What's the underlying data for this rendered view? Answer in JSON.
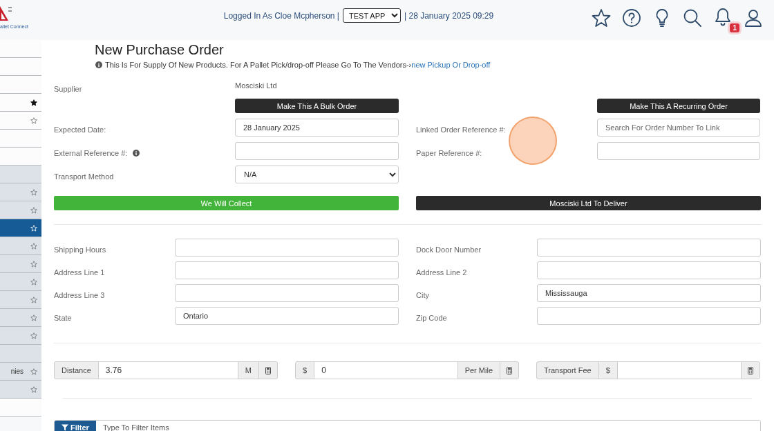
{
  "header": {
    "logo_text": "allet Connect",
    "user_text": "Logged In As Cloe Mcpherson |",
    "app_select": "TEST APP",
    "datetime": "| 28 January 2025 09:29",
    "notification_count": "1"
  },
  "sidebar": {
    "items": [
      {
        "selected": false,
        "shaded": false
      },
      {
        "selected": false,
        "shaded": false
      },
      {
        "selected": false,
        "shaded": false
      },
      {
        "selected": false,
        "shaded": false,
        "starred": true
      },
      {
        "selected": false,
        "shaded": false,
        "starred": false
      },
      {
        "selected": false,
        "shaded": false
      },
      {
        "selected": false,
        "shaded": false
      },
      {
        "selected": false,
        "shaded": true
      },
      {
        "selected": false,
        "shaded": true,
        "starred": false
      },
      {
        "selected": false,
        "shaded": true,
        "starred": false
      },
      {
        "selected": true,
        "shaded": true,
        "starred": false
      },
      {
        "selected": false,
        "shaded": true,
        "starred": false
      },
      {
        "selected": false,
        "shaded": true,
        "starred": false
      },
      {
        "selected": false,
        "shaded": true,
        "starred": false
      },
      {
        "selected": false,
        "shaded": true,
        "starred": false
      },
      {
        "selected": false,
        "shaded": true,
        "starred": false
      },
      {
        "selected": false,
        "shaded": true,
        "starred": false
      },
      {
        "selected": false,
        "shaded": true
      },
      {
        "selected": false,
        "shaded": true,
        "starred": false,
        "label": "nies"
      },
      {
        "selected": false,
        "shaded": true,
        "starred": false
      },
      {
        "selected": false,
        "shaded": false
      }
    ]
  },
  "page": {
    "title": "New Purchase Order",
    "notice": "This Is For Supply Of New Products. For A Pallet Pick/drop-off Please Go To The Vendors-›",
    "notice_link": "new Pickup Or Drop-off"
  },
  "order_form": {
    "supplier": {
      "label": "Supplier",
      "value": "Mosciski Ltd"
    },
    "bulk_order_button": "Make This A Bulk Order",
    "recurring_order_button": "Make This A Recurring Order",
    "fields_left": [
      {
        "label": "Expected Date:",
        "kind": "input",
        "value": "28 January 2025"
      },
      {
        "label": "External Reference #:",
        "kind": "input",
        "info": true
      },
      {
        "label": "Transport Method",
        "kind": "select",
        "value": "N/A"
      }
    ],
    "fields_right": [
      {
        "label": "Linked Order Reference #:",
        "kind": "input",
        "placeholder": "Search For Order Number To Link"
      },
      {
        "label": "Paper Reference #:",
        "kind": "input"
      }
    ],
    "collect_button": {
      "label": "We Will Collect",
      "selected": true
    },
    "deliver_button": {
      "label": "Mosciski Ltd To Deliver",
      "selected": false
    }
  },
  "address": {
    "left": [
      {
        "label": "Shipping Hours"
      },
      {
        "label": "Address Line 1"
      },
      {
        "label": "Address Line 3"
      },
      {
        "label": "State",
        "value": "Ontario"
      }
    ],
    "right": [
      {
        "label": "Dock Door Number"
      },
      {
        "label": "Address Line 2"
      },
      {
        "label": "City",
        "value": "Mississauga"
      },
      {
        "label": "Zip Code"
      }
    ]
  },
  "costs": [
    [
      {
        "kind": "addon",
        "text": "Distance"
      },
      {
        "kind": "input",
        "value": "3.76"
      },
      {
        "kind": "addon",
        "text": "M"
      },
      {
        "kind": "calculator"
      }
    ],
    [
      {
        "kind": "addon",
        "text": "$"
      },
      {
        "kind": "input",
        "value": "0"
      },
      {
        "kind": "addon",
        "text": "Per Mile"
      },
      {
        "kind": "calculator"
      }
    ],
    [
      {
        "kind": "addon",
        "text": "Transport Fee"
      },
      {
        "kind": "addon",
        "text": "$"
      },
      {
        "kind": "input"
      },
      {
        "kind": "calculator"
      }
    ]
  ],
  "filter": {
    "button": "Filter",
    "placeholder": "Type To Filter Items"
  }
}
